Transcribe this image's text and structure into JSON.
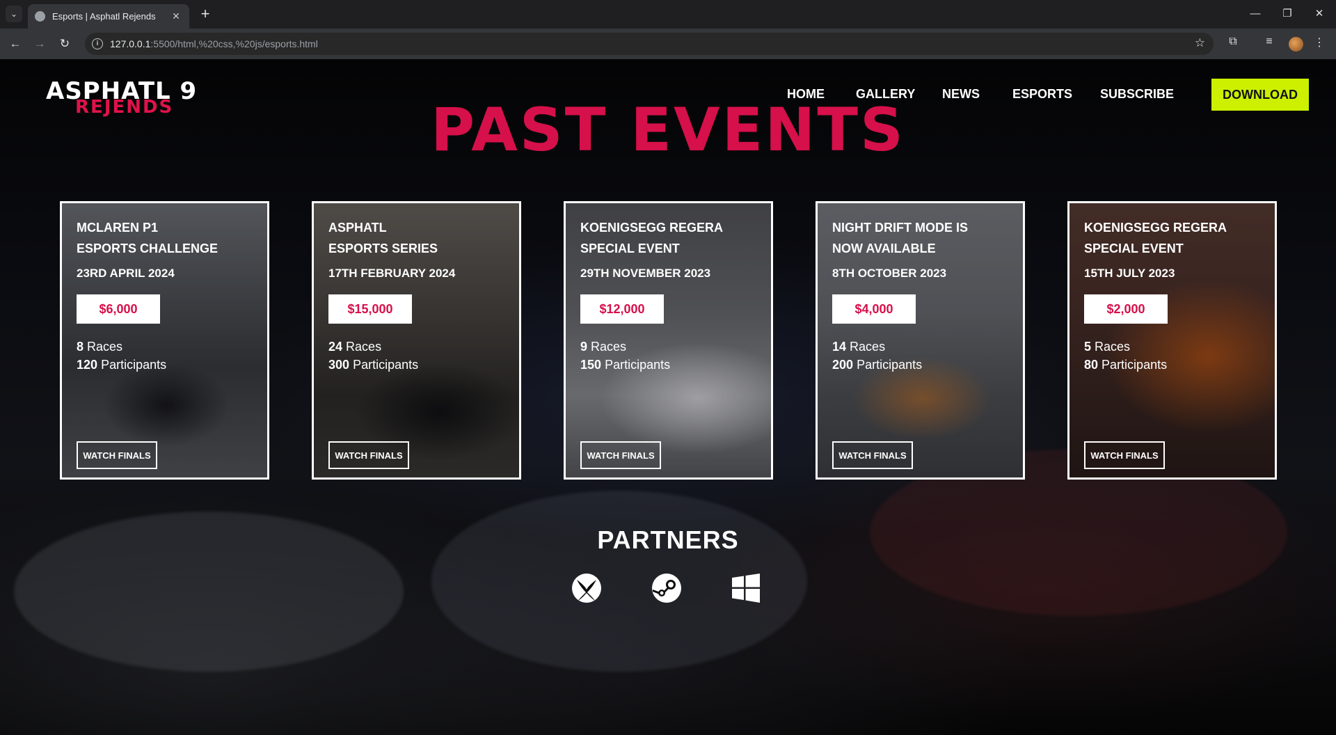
{
  "browser": {
    "tab_title": "Esports | Asphatl Rejends",
    "url_host": "127.0.0.1",
    "url_path": ":5500/html,%20css,%20js/esports.html"
  },
  "site": {
    "logo_line1": "ASPHATL 9",
    "logo_line2": "REJENDS",
    "nav": [
      "HOME",
      "GALLERY",
      "NEWS",
      "ESPORTS",
      "SUBSCRIBE"
    ],
    "download_label": "DOWNLOAD",
    "headline": "PAST EVENTS",
    "accent_color": "#d6104a",
    "download_color": "#ccf000"
  },
  "events": [
    {
      "title_line1": "MCLAREN P1",
      "title_line2": "ESPORTS CHALLENGE",
      "date": "23RD APRIL 2024",
      "prize": "$6,000",
      "races": "8",
      "races_label": "Races",
      "participants": "120",
      "participants_label": "Participants",
      "cta": "WATCH FINALS"
    },
    {
      "title_line1": "ASPHATL",
      "title_line2": "ESPORTS SERIES",
      "date": "17TH FEBRUARY 2024",
      "prize": "$15,000",
      "races": "24",
      "races_label": "Races",
      "participants": "300",
      "participants_label": "Participants",
      "cta": "WATCH FINALS"
    },
    {
      "title_line1": "KOENIGSEGG REGERA",
      "title_line2": "SPECIAL EVENT",
      "date": "29TH NOVEMBER 2023",
      "prize": "$12,000",
      "races": "9",
      "races_label": "Races",
      "participants": "150",
      "participants_label": "Participants",
      "cta": "WATCH FINALS"
    },
    {
      "title_line1": "NIGHT DRIFT MODE IS",
      "title_line2": "NOW AVAILABLE",
      "date": "8TH OCTOBER 2023",
      "prize": "$4,000",
      "races": "14",
      "races_label": "Races",
      "participants": "200",
      "participants_label": "Participants",
      "cta": "WATCH FINALS"
    },
    {
      "title_line1": "KOENIGSEGG REGERA",
      "title_line2": "SPECIAL EVENT",
      "date": "15TH JULY 2023",
      "prize": "$2,000",
      "races": "5",
      "races_label": "Races",
      "participants": "80",
      "participants_label": "Participants",
      "cta": "WATCH FINALS"
    }
  ],
  "partners": {
    "title": "PARTNERS",
    "icons": [
      "xbox-icon",
      "steam-icon",
      "windows-icon"
    ]
  }
}
